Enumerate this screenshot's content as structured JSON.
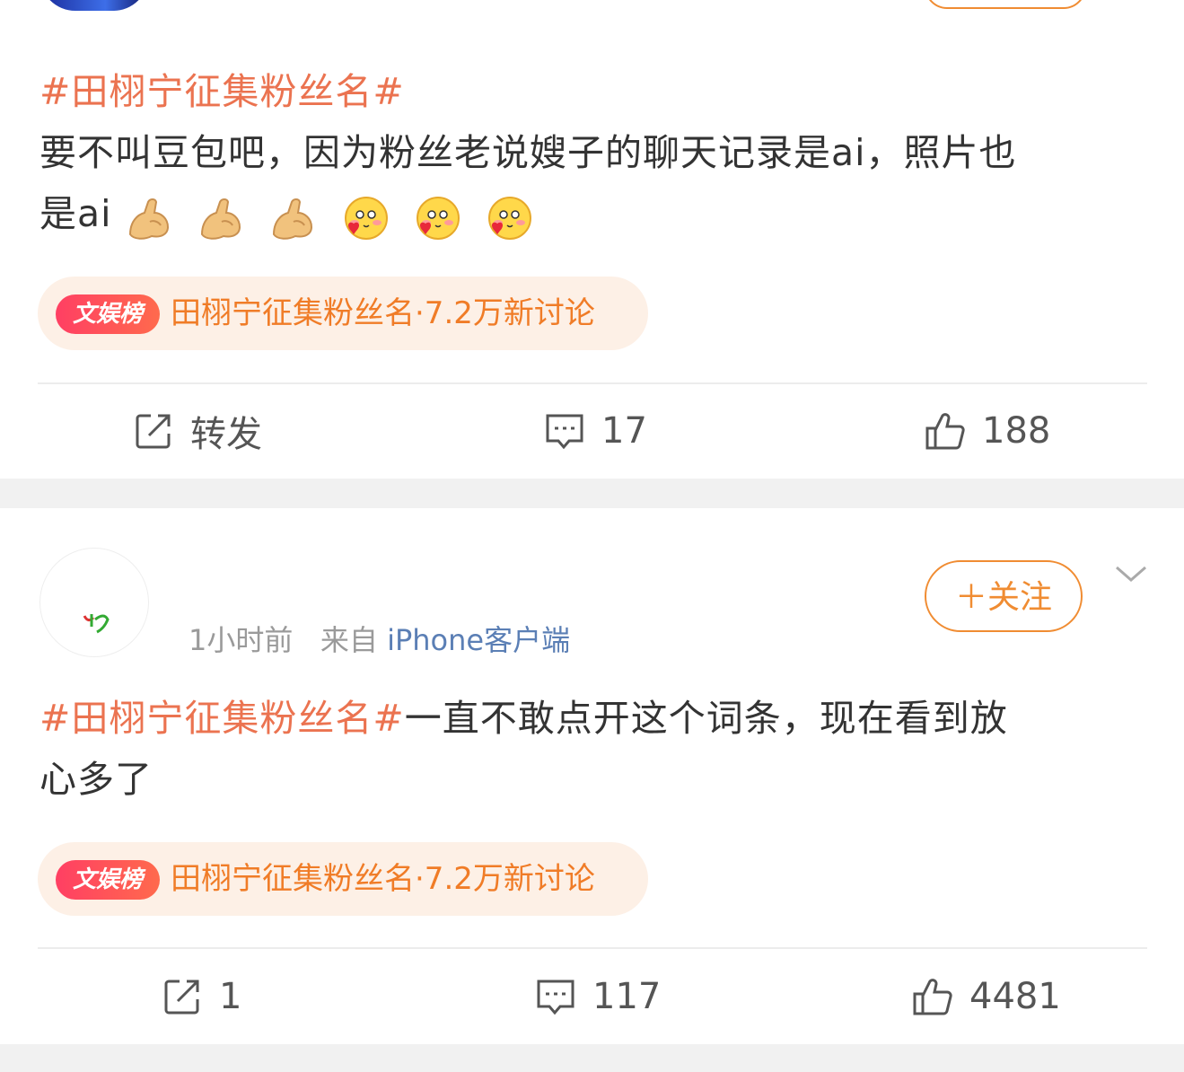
{
  "post1": {
    "hashtag": "#田栩宁征集粉丝名#",
    "text_line1": "要不叫豆包吧，因为粉丝老说嫂子的聊天记录是ai，照片也",
    "text_line2": "是ai",
    "emojis": [
      "flexed-biceps-icon",
      "flexed-biceps-icon",
      "flexed-biceps-icon",
      "love-face-icon",
      "love-face-icon",
      "love-face-icon"
    ],
    "topic_badge": "文娱榜",
    "topic_text": "田栩宁征集粉丝名·7.2万新讨论",
    "repost_label": "转发",
    "comment_count": "17",
    "like_count": "188"
  },
  "post2": {
    "time": "1小时前",
    "from": "来自",
    "source": "iPhone客户端",
    "follow_label": "＋关注",
    "hashtag": "#田栩宁征集粉丝名#",
    "text_rest": "一直不敢点开这个词条，现在看到放",
    "text_line2": "心多了",
    "topic_badge": "文娱榜",
    "topic_text": "田栩宁征集粉丝名·7.2万新讨论",
    "repost_count": "1",
    "comment_count": "117",
    "like_count": "4481"
  },
  "colors": {
    "hashtag": "#eb7350",
    "follow": "#f08c32",
    "source_link": "#5b7fb5",
    "topic_text": "#f07c27"
  }
}
